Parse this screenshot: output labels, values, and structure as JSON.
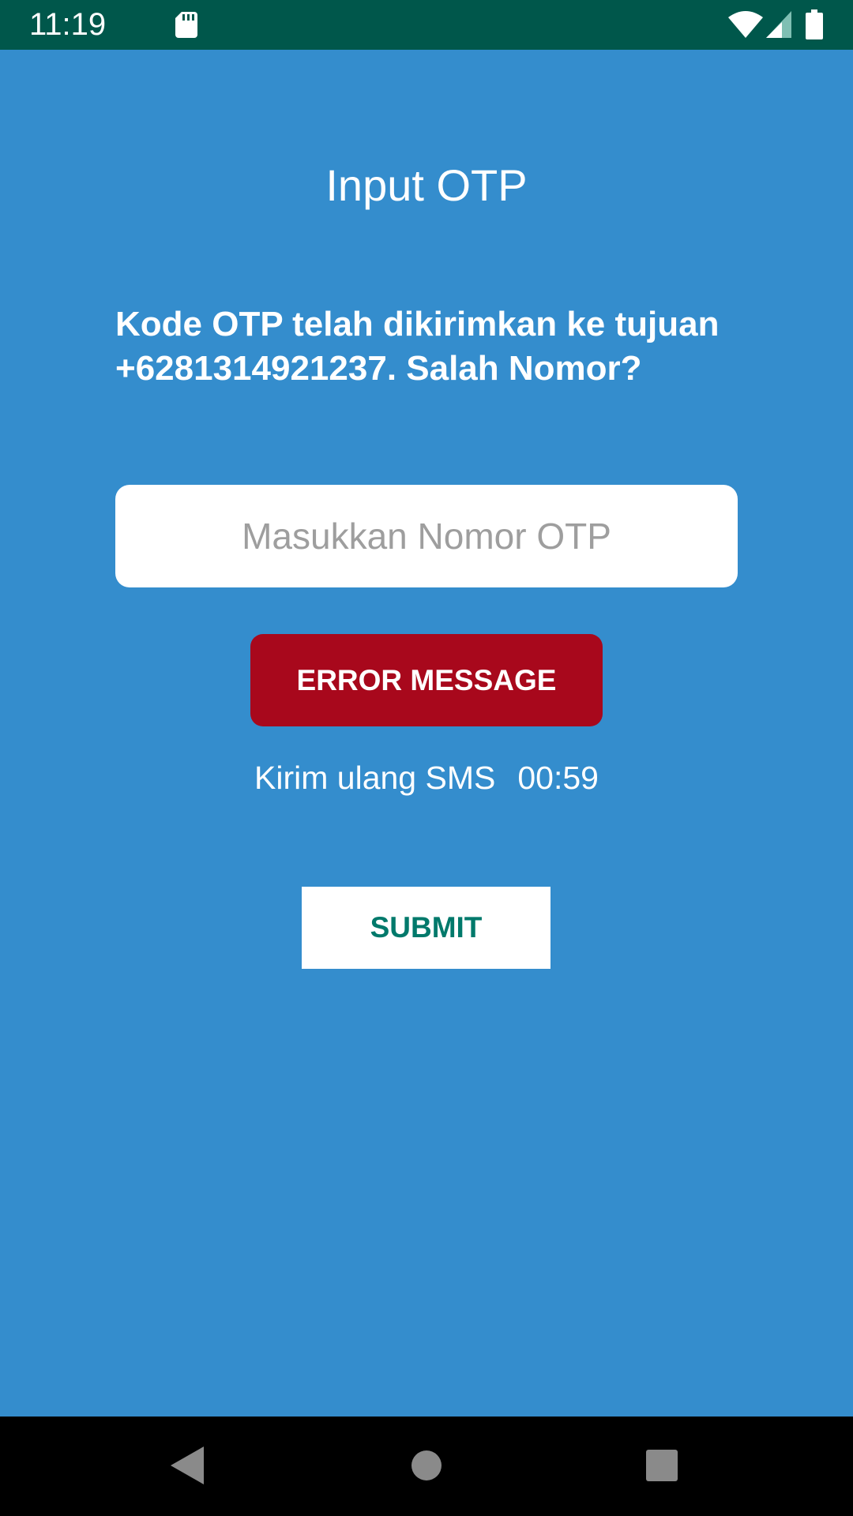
{
  "status_bar": {
    "time": "11:19",
    "icons": [
      "sd-card-icon",
      "wifi-icon",
      "signal-icon",
      "battery-icon"
    ]
  },
  "page": {
    "title": "Input OTP",
    "info_text": "Kode OTP telah dikirimkan ke tujuan +6281314921237. Salah Nomor?",
    "otp_input": {
      "placeholder": "Masukkan Nomor OTP",
      "value": ""
    },
    "error_message": "ERROR MESSAGE",
    "resend_label": "Kirim ulang SMS",
    "resend_timer": "00:59",
    "submit_label": "SUBMIT"
  },
  "nav_bar": {
    "icons": [
      "back-icon",
      "home-icon",
      "recents-icon"
    ]
  },
  "colors": {
    "background": "#348dcd",
    "status_bar": "#00574b",
    "error": "#a8081c",
    "submit_text": "#00796b"
  }
}
